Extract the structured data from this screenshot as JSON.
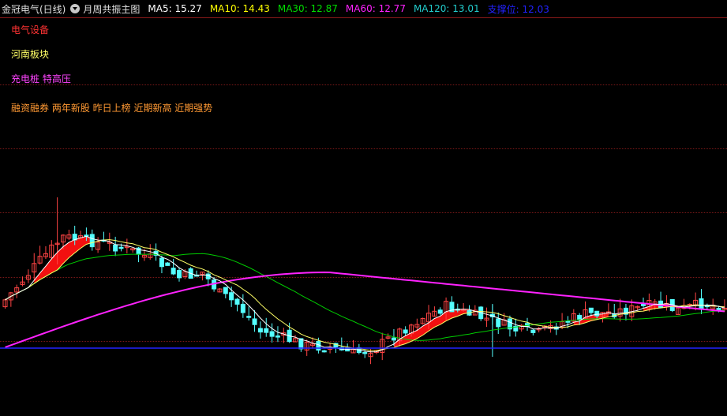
{
  "header": {
    "title": "金冠电气(日线)",
    "indicator_name": "月周共振主图",
    "ma": [
      {
        "label": "MA5: 15.27",
        "color": "#ffffff"
      },
      {
        "label": "MA10: 14.43",
        "color": "#ffff00"
      },
      {
        "label": "MA30: 12.87",
        "color": "#00dd00"
      },
      {
        "label": "MA60: 12.77",
        "color": "#ff22ff"
      },
      {
        "label": "MA120: 13.01",
        "color": "#22cccc"
      },
      {
        "label": "支撑位: 12.03",
        "color": "#2222ff"
      }
    ]
  },
  "tags": {
    "industry": "电气设备",
    "region": "河南板块",
    "concepts": "充电桩 特高压",
    "features": "融资融券 两年新股 昨日上榜 近期新高 近期强势"
  },
  "colors": {
    "up": "#ff4444",
    "down": "#54ffff",
    "ma5": "#ffffff",
    "ma10": "#ffff66",
    "ma30": "#00cc00",
    "ma60": "#ff22ff",
    "support": "#2222ff",
    "tag_industry": "#ff3333",
    "tag_region": "#ffff66",
    "tag_concepts": "#ff44ff",
    "tag_features": "#ff9933"
  }
}
